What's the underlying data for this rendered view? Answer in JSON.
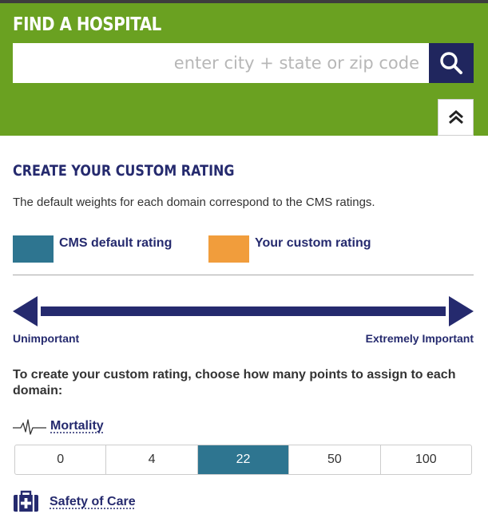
{
  "header": {
    "title": "FIND A HOSPITAL",
    "search_placeholder": "enter city + state or zip code",
    "search_icon": "magnifier-icon",
    "collapse_icon": "double-chevron-up-icon"
  },
  "custom_rating": {
    "title": "CREATE YOUR CUSTOM RATING",
    "intro": "The default weights for each domain correspond to the CMS ratings.",
    "legend": [
      {
        "label": "CMS default rating",
        "color": "#2e7590"
      },
      {
        "label": "Your custom rating",
        "color": "#f19d3c"
      }
    ],
    "scale": {
      "low_label": "Unimportant",
      "high_label": "Extremely Important",
      "icon": "double-headed-arrow-icon"
    },
    "instructions": "To create your custom rating, choose how many points to assign to each domain:",
    "domains": [
      {
        "name": "Mortality",
        "icon": "heartbeat-icon",
        "options": [
          "0",
          "4",
          "22",
          "50",
          "100"
        ],
        "selected": "22"
      },
      {
        "name": "Safety of Care",
        "icon": "first-aid-kit-icon"
      }
    ]
  },
  "colors": {
    "header_green": "#6aa121",
    "navy": "#252a6e",
    "search_button": "#20265e",
    "teal": "#2e7590",
    "orange": "#f19d3c"
  }
}
